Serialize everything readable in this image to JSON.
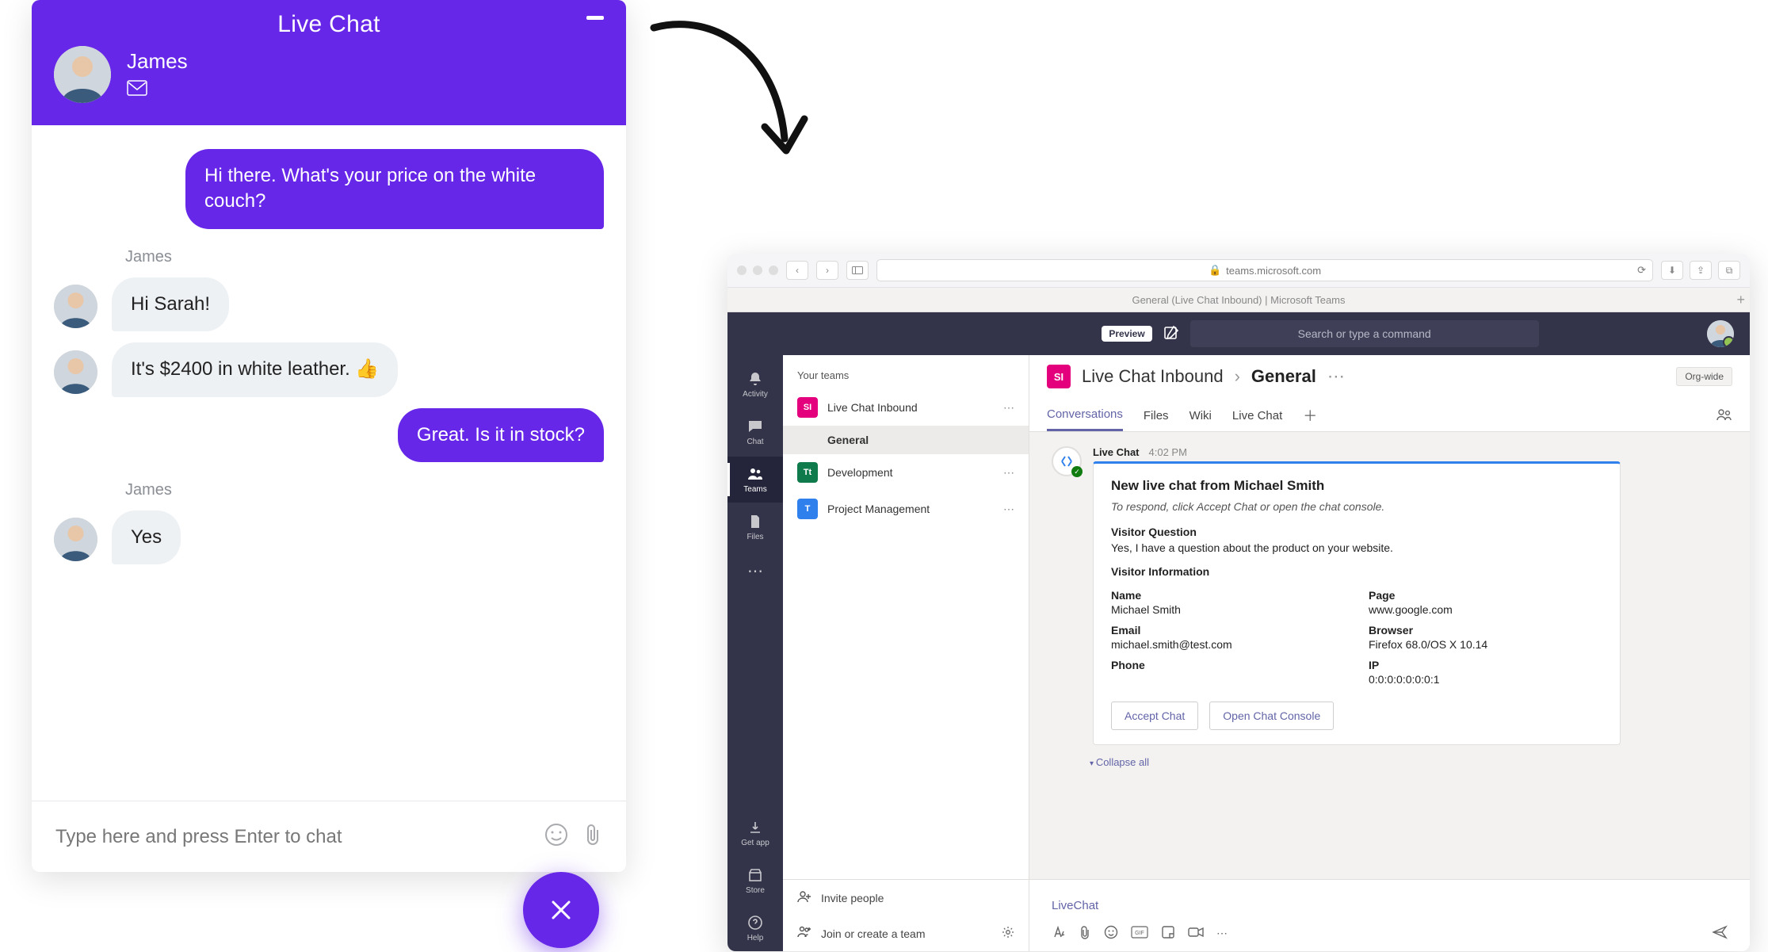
{
  "livechat": {
    "title": "Live Chat",
    "agent_name": "James",
    "input_placeholder": "Type here and press Enter to chat",
    "messages": {
      "m1": "Hi there. What's your price on the white couch?",
      "m2_sender": "James",
      "m2": "Hi Sarah!",
      "m3": "It's $2400 in white leather. 👍",
      "m4": "Great. Is it in stock?",
      "m5_sender": "James",
      "m5": "Yes"
    }
  },
  "browser": {
    "url": "teams.microsoft.com",
    "tab_title": "General (Live Chat Inbound) | Microsoft Teams"
  },
  "teams": {
    "preview_badge": "Preview",
    "search_placeholder": "Search or type a command",
    "rail": {
      "activity": "Activity",
      "chat": "Chat",
      "teams": "Teams",
      "files": "Files",
      "getapp": "Get app",
      "store": "Store",
      "help": "Help"
    },
    "list": {
      "header": "Your teams",
      "team1": "Live Chat Inbound",
      "team1_initials": "SI",
      "channel_general": "General",
      "team2": "Development",
      "team2_initials": "Tt",
      "team3": "Project Management",
      "team3_initials": "T",
      "invite": "Invite people",
      "join": "Join or create a team"
    },
    "header": {
      "sq_initials": "SI",
      "team_name": "Live Chat Inbound",
      "channel": "General",
      "org_badge": "Org-wide"
    },
    "tabs": {
      "conversations": "Conversations",
      "files": "Files",
      "wiki": "Wiki",
      "livechat": "Live Chat"
    },
    "post": {
      "sender": "Live Chat",
      "time": "4:02 PM",
      "title": "New live chat from Michael Smith",
      "subtitle": "To respond, click Accept Chat or open the chat console.",
      "q_heading": "Visitor Question",
      "question": "Yes, I have a question about the product on your website.",
      "info_heading": "Visitor Information",
      "k_name": "Name",
      "v_name": "Michael Smith",
      "k_page": "Page",
      "v_page": "www.google.com",
      "k_email": "Email",
      "v_email": "michael.smith@test.com",
      "k_browser": "Browser",
      "v_browser": "Firefox 68.0/OS X 10.14",
      "k_phone": "Phone",
      "k_ip": "IP",
      "v_ip": "0:0:0:0:0:0:0:1",
      "btn_accept": "Accept Chat",
      "btn_console": "Open Chat Console",
      "collapse": "Collapse all"
    },
    "composer": {
      "reply_label": "LiveChat"
    }
  }
}
